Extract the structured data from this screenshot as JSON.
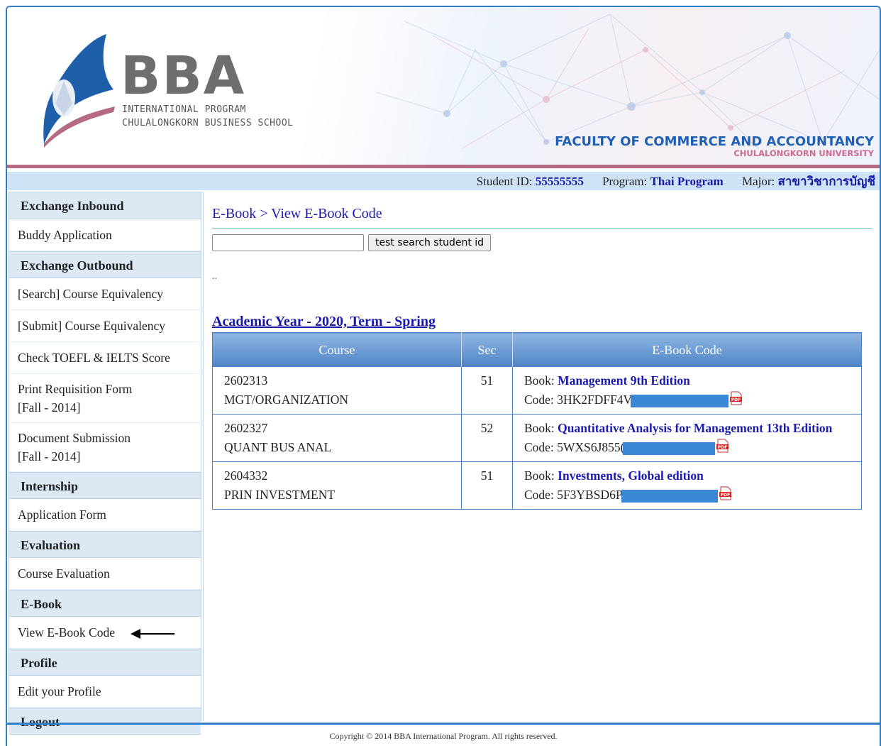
{
  "banner": {
    "logo_text": "BBA",
    "logo_line1": "INTERNATIONAL PROGRAM",
    "logo_line2": "CHULALONGKORN BUSINESS SCHOOL",
    "faculty_line1": "FACULTY OF COMMERCE AND ACCOUNTANCY",
    "faculty_line2": "CHULALONGKORN UNIVERSITY"
  },
  "infobar": {
    "student_id_label": "Student ID:",
    "student_id": "55555555",
    "program_label": "Program:",
    "program": "Thai Program",
    "major_label": "Major:",
    "major": "สาขาวิชาการบัญชี"
  },
  "sidebar": {
    "exchange_inbound": "Exchange Inbound",
    "buddy_application": "Buddy Application",
    "exchange_outbound": "Exchange Outbound",
    "search_course_equivalency": "[Search] Course Equivalency",
    "submit_course_equivalency": "[Submit] Course Equivalency",
    "check_toefl": "Check TOEFL & IELTS Score",
    "print_requisition_line1": "Print Requisition Form",
    "print_requisition_line2": "[Fall - 2014]",
    "document_submission_line1": "Document Submission",
    "document_submission_line2": "[Fall - 2014]",
    "internship": "Internship",
    "application_form": "Application Form",
    "evaluation": "Evaluation",
    "course_evaluation": "Course Evaluation",
    "ebook": "E-Book",
    "view_ebook_code": "View E-Book Code",
    "profile": "Profile",
    "edit_profile": "Edit your Profile",
    "logout": "Logout"
  },
  "main": {
    "breadcrumb": "E-Book > View E-Book Code",
    "search_button": "test search student id",
    "search_value": "",
    "dots": "..",
    "year_title": "Academic Year - 2020, Term - Spring",
    "table": {
      "headers": [
        "Course",
        "Sec",
        "E-Book Code"
      ],
      "book_label": "Book:",
      "code_label": "Code:",
      "rows": [
        {
          "course_code": "2602313",
          "course_name": "MGT/ORGANIZATION",
          "sec": "51",
          "book": "Management 9th Edition",
          "code": "3HK2FDFF4V"
        },
        {
          "course_code": "2602327",
          "course_name": "QUANT BUS ANAL",
          "sec": "52",
          "book": "Quantitative Analysis for Management 13th Edition",
          "code": "5WXS6J855("
        },
        {
          "course_code": "2604332",
          "course_name": "PRIN INVESTMENT",
          "sec": "51",
          "book": "Investments, Global edition",
          "code": "5F3YBSD6P"
        }
      ]
    }
  },
  "footer": {
    "copyright": "Copyright © 2014 BBA International Program. All rights reserved."
  },
  "colors": {
    "accent_blue": "#2f7fc8",
    "link_blue": "#1a1ab0",
    "sidebar_header_bg": "#dce8f4",
    "infobar_bg": "#cfe3f7",
    "table_header": "#4d84c6",
    "redaction": "#3d88d4"
  },
  "icons": [
    "university-emblem-icon",
    "pdf-icon",
    "arrow-left-icon"
  ]
}
